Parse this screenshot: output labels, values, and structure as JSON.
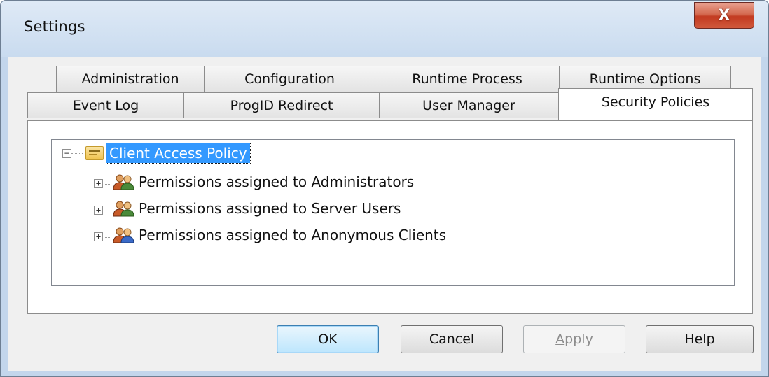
{
  "window": {
    "title": "Settings",
    "close_glyph": "X"
  },
  "tabs": {
    "row1": [
      "Administration",
      "Configuration",
      "Runtime Process",
      "Runtime Options"
    ],
    "row2": [
      "Event Log",
      "ProgID Redirect",
      "User Manager",
      "Security Policies"
    ],
    "active": "Security Policies"
  },
  "tree": {
    "root": {
      "label": "Client Access Policy",
      "icon": "policy-icon",
      "expander": "−",
      "selected": true
    },
    "children": [
      {
        "label": "Permissions assigned to Administrators",
        "icon": "users-icon",
        "expander": "+"
      },
      {
        "label": "Permissions assigned to Server Users",
        "icon": "users-icon",
        "expander": "+"
      },
      {
        "label": "Permissions assigned to Anonymous Clients",
        "icon": "users-icon",
        "expander": "+"
      }
    ]
  },
  "buttons": {
    "ok": "OK",
    "cancel": "Cancel",
    "apply_prefix": "",
    "apply_underlined": "A",
    "apply_rest": "pply",
    "help": "Help"
  },
  "colors": {
    "selection": "#3399ff",
    "close_button": "#c23a20",
    "frame": "#c3d6ec"
  }
}
